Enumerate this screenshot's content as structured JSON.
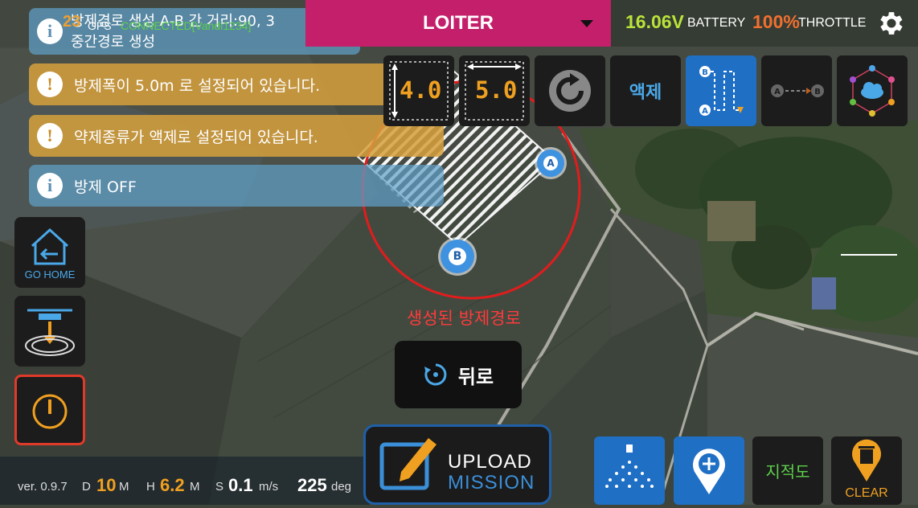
{
  "status": {
    "gps_count": "23",
    "gps_label": "GPS",
    "gps_connection": "CONNECTED[Vandi1234]",
    "flight_mode": "LOITER",
    "voltage": "16.06V",
    "battery_label": "BATTERY",
    "throttle": "100%",
    "throttle_label": "THROTTLE"
  },
  "notifications": [
    {
      "type": "info",
      "line1": "방제경로 생성 A-B 간 거리:90, 3",
      "line2": "중간경로 생성"
    },
    {
      "type": "warning",
      "text": "방제폭이 5.0m 로 설정되어 있습니다."
    },
    {
      "type": "warning",
      "text": "약제종류가 액제로 설정되어 있습니다."
    },
    {
      "type": "info",
      "text": "방제 OFF"
    }
  ],
  "toolbar": {
    "height_value": "4.0",
    "width_value": "5.0",
    "chemical_label": "액제"
  },
  "left_buttons": {
    "go_home_label": "GO HOME"
  },
  "map": {
    "point_a": "A",
    "point_b": "B",
    "annotation": "생성된 방제경로"
  },
  "back_button": {
    "label": "뒤로"
  },
  "upload_button": {
    "line1": "UPLOAD",
    "line2": "MISSION"
  },
  "bottom_right": {
    "map_label": "지적도",
    "clear_label": "CLEAR"
  },
  "telemetry": {
    "version": "ver. 0.9.7",
    "d_label": "D",
    "d_value": "10",
    "d_unit": "M",
    "h_label": "H",
    "h_value": "6.2",
    "h_unit": "M",
    "s_label": "S",
    "s_value": "0.1",
    "s_unit": "m/s",
    "heading_value": "225",
    "heading_unit": "deg"
  },
  "colors": {
    "mode_bg": "#c41f6b",
    "voltage": "#b9e33a",
    "throttle": "#f07030",
    "gps_count": "#f0a030",
    "gps_connected": "#5cd04a",
    "accent_blue": "#1f6fc4",
    "annotation_red": "#ff3a3a"
  }
}
